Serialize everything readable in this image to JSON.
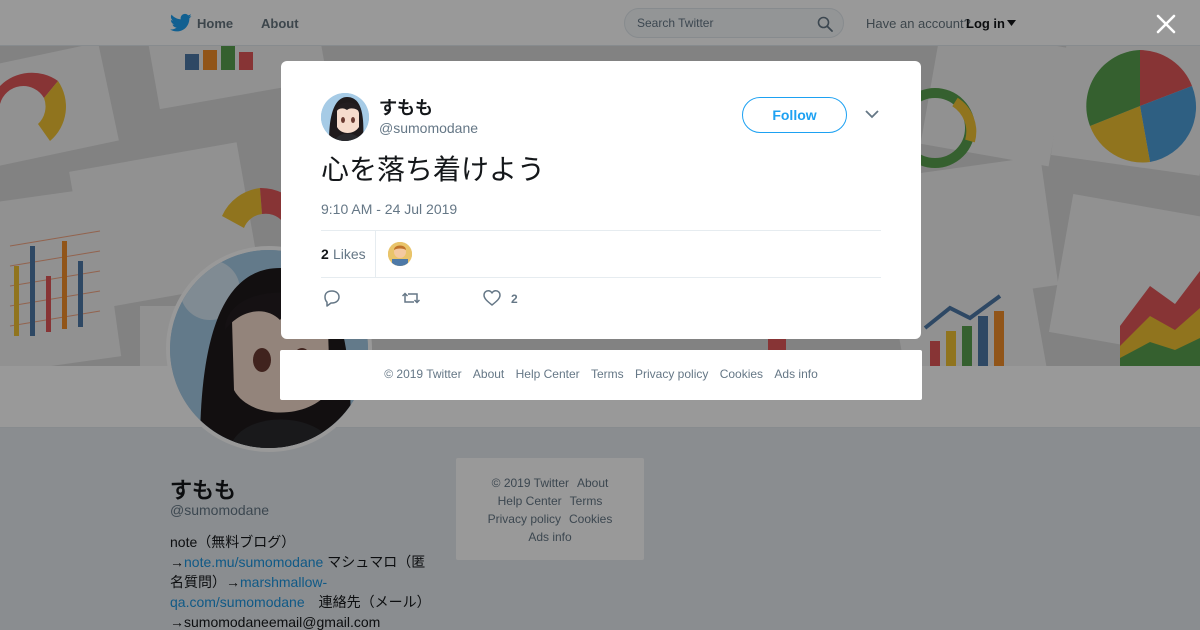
{
  "topbar": {
    "home_label": "Home",
    "about_label": "About",
    "search_placeholder": "Search Twitter",
    "have_account": "Have an account?",
    "login_label": "Log in"
  },
  "profile": {
    "name": "すもも",
    "handle": "@sumomodane",
    "bio": {
      "line1": "note（無料ブログ）",
      "arrow1": "→",
      "link1": "note.mu/sumomodane",
      "text2": " マシュマロ（匿名質問）→",
      "link2": "marshmallow-qa.com/sumomodane",
      "text3": "　連絡先（メール）→sumomodaneemail@gmail.com"
    }
  },
  "sidebar_footer": {
    "items": [
      "© 2019 Twitter",
      "About",
      "Help Center",
      "Terms",
      "Privacy policy",
      "Cookies",
      "Ads info"
    ]
  },
  "tweet": {
    "author_name": "すもも",
    "author_handle": "@sumomodane",
    "follow_label": "Follow",
    "text": "心を落ち着けよう",
    "timestamp": "9:10 AM - 24 Jul 2019",
    "likes_count": "2",
    "likes_label": "Likes",
    "action_like_count": "2"
  },
  "modal_footer": {
    "items": [
      "© 2019 Twitter",
      "About",
      "Help Center",
      "Terms",
      "Privacy policy",
      "Cookies",
      "Ads info"
    ]
  },
  "colors": {
    "accent": "#1da1f2",
    "link": "#1b95e0",
    "muted": "#657786"
  },
  "icons": [
    "twitter-bird-icon",
    "search-icon",
    "caret-down-icon",
    "close-icon",
    "chevron-down-icon",
    "reply-icon",
    "retweet-icon",
    "heart-icon"
  ]
}
